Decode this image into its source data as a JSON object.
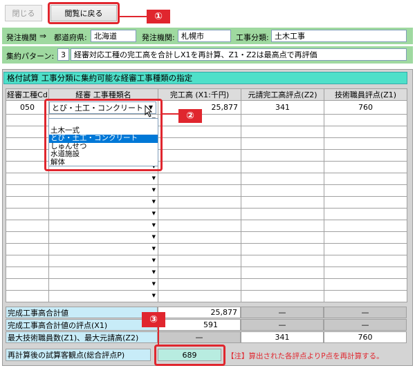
{
  "toolbar": {
    "close_label": "閉じる",
    "back_label": "閲覧に戻る"
  },
  "callouts": {
    "c1": "①",
    "c2": "②",
    "c3": "③"
  },
  "header": {
    "orderer_label": "発注機関",
    "arrow": "⇒",
    "prefecture_label": "都道府県:",
    "prefecture_value": "北海道",
    "orderer2_label": "発注機関:",
    "orderer2_value": "札幌市",
    "category_label": "工事分類:",
    "category_value": "土木工事",
    "pattern_label": "集約パターン:",
    "pattern_number": "3",
    "pattern_desc": "経審対応工種の完工高を合計しX1を再計算、Z1・Z2は最高点で再評価"
  },
  "panel": {
    "title": "格付試算 工事分類に集約可能な経審工事種類の指定"
  },
  "grid": {
    "columns": [
      "経審工種Cd",
      "経審 工事種類名",
      "完工高 (X1:千円)",
      "元請完工高評点(Z2)",
      "技術職員評点(Z1)"
    ],
    "first_row": {
      "code": "050",
      "type": "とび・土工・コンクリート",
      "amount": "25,877",
      "z2": "341",
      "z1": "760"
    }
  },
  "dropdown": {
    "options": [
      "",
      "土木一式",
      "とび・土工・コンクリート",
      "しゅんせつ",
      "水道施設",
      "解体"
    ],
    "selected_index": 2
  },
  "summary": {
    "total_label": "完成工事高合計値",
    "total_value": "25,877",
    "total_dash1": "—",
    "total_dash2": "—",
    "score_label": "完成工事高合計値の評点(X1)",
    "score_value": "591",
    "score_dash1": "—",
    "score_dash2": "—",
    "max_label": "最大技術職員数(Z1)、最大元請高(Z2)",
    "max_dash": "—",
    "max_z2": "341",
    "max_z1": "760",
    "recalc_label": "再計算後の試算客観点(総合評点P)",
    "recalc_value": "689",
    "note": "【注】算出された各評点よりP点を再計算する。"
  },
  "colors": {
    "accent_red": "#e0262e",
    "header_green": "#9fd9a0",
    "title_teal": "#4ee0c9",
    "label_blue": "#c8ecf8"
  }
}
